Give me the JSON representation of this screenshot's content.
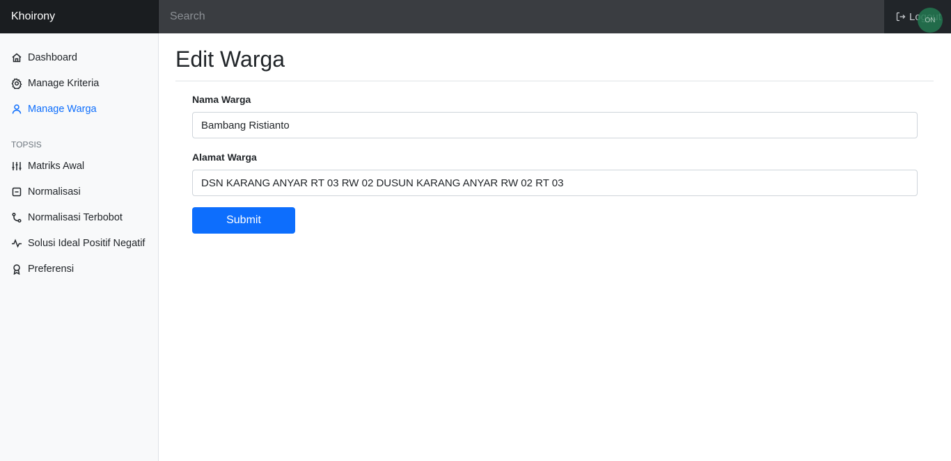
{
  "brand": "Khoirony",
  "search": {
    "placeholder": "Search",
    "value": ""
  },
  "logout_label": "Logout",
  "floating_badge": "ON",
  "sidebar": {
    "items": [
      {
        "label": "Dashboard",
        "icon": "house-icon",
        "active": false
      },
      {
        "label": "Manage Kriteria",
        "icon": "gear-icon",
        "active": false
      },
      {
        "label": "Manage Warga",
        "icon": "user-icon",
        "active": true
      }
    ],
    "section_heading": "TOPSIS",
    "topsis_items": [
      {
        "label": "Matriks Awal",
        "icon": "sliders-icon"
      },
      {
        "label": "Normalisasi",
        "icon": "file-minus-icon"
      },
      {
        "label": "Normalisasi Terbobot",
        "icon": "git-branch-icon"
      },
      {
        "label": "Solusi Ideal Positif Negatif",
        "icon": "activity-icon"
      },
      {
        "label": "Preferensi",
        "icon": "award-icon"
      }
    ]
  },
  "page": {
    "title": "Edit Warga",
    "form": {
      "nama_label": "Nama Warga",
      "nama_value": "Bambang Ristianto",
      "alamat_label": "Alamat Warga",
      "alamat_value": "DSN KARANG ANYAR RT 03 RW 02 DUSUN KARANG ANYAR RW 02 RT 03",
      "submit_label": "Submit"
    }
  },
  "colors": {
    "accent": "#0d6efd",
    "topbar": "#212529",
    "sidebar_bg": "#f8f9fa"
  }
}
